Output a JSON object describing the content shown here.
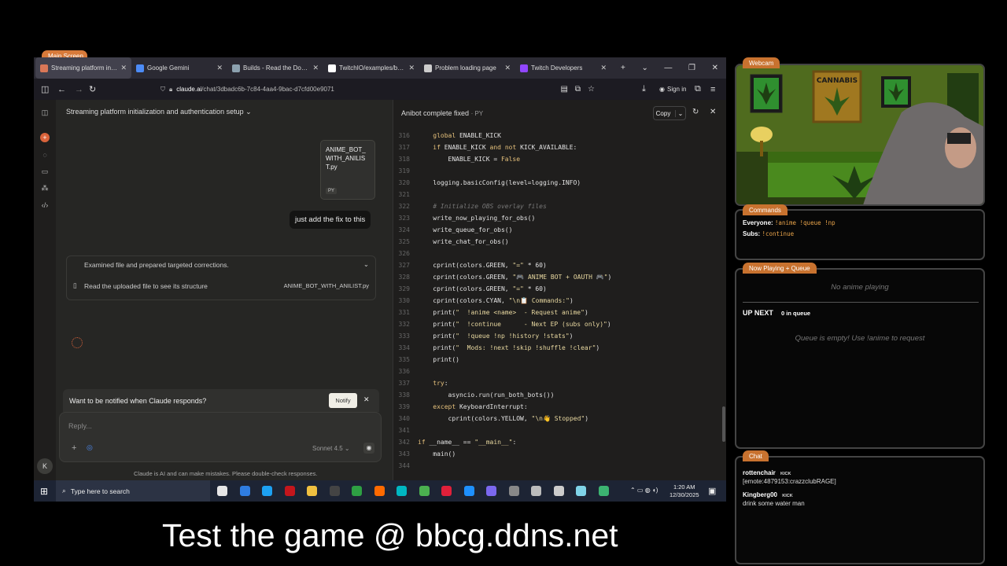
{
  "scene_label": "Main Screen",
  "browser": {
    "tabs": [
      {
        "title": "Streaming platform initializati",
        "active": true,
        "favicon_color": "#d97757"
      },
      {
        "title": "Google Gemini",
        "active": false,
        "favicon_color": "#4c8bf5"
      },
      {
        "title": "Builds - Read the Docs Comm",
        "active": false,
        "favicon_color": "#8ca1af"
      },
      {
        "title": "TwitchIO/examples/basic_bot",
        "active": false,
        "favicon_color": "#ffffff"
      },
      {
        "title": "Problem loading page",
        "active": false,
        "favicon_color": "#cccccc"
      },
      {
        "title": "Twitch Developers",
        "active": false,
        "favicon_color": "#9146ff"
      }
    ],
    "url_host": "claude.ai",
    "url_path": "/chat/3dbadc6b-7c84-4aa4-9bac-d7cfd00e9071",
    "sign_in": "Sign in"
  },
  "chat": {
    "title": "Streaming platform initialization and authentication setup",
    "attachment": {
      "name": "ANIME_BOT_WITH_ANILIST.py",
      "type": "PY"
    },
    "user_message": "just add the fix to this",
    "step_summary": "Examined file and prepared targeted corrections.",
    "step_detail": "Read the uploaded file to see its structure",
    "step_file": "ANIME_BOT_WITH_ANILIST.py",
    "notify_prompt": "Want to be notified when Claude responds?",
    "notify_button": "Notify",
    "reply_placeholder": "Reply...",
    "model": "Sonnet 4.5",
    "disclaimer": "Claude is AI and can make mistakes. Please double-check responses.",
    "avatar_initial": "K"
  },
  "code_panel": {
    "title": "Anibot complete fixed",
    "ext": "· PY",
    "copy_label": "Copy",
    "lines": [
      {
        "n": "316",
        "code": "    global ENABLE_KICK"
      },
      {
        "n": "317",
        "code": "    if ENABLE_KICK and not KICK_AVAILABLE:"
      },
      {
        "n": "318",
        "code": "        ENABLE_KICK = False"
      },
      {
        "n": "319",
        "code": ""
      },
      {
        "n": "320",
        "code": "    logging.basicConfig(level=logging.INFO)"
      },
      {
        "n": "321",
        "code": ""
      },
      {
        "n": "322",
        "code": "    # Initialize OBS overlay files"
      },
      {
        "n": "323",
        "code": "    write_now_playing_for_obs()"
      },
      {
        "n": "324",
        "code": "    write_queue_for_obs()"
      },
      {
        "n": "325",
        "code": "    write_chat_for_obs()"
      },
      {
        "n": "326",
        "code": ""
      },
      {
        "n": "327",
        "code": "    cprint(colors.GREEN, \"=\" * 60)"
      },
      {
        "n": "328",
        "code": "    cprint(colors.GREEN, \"🎮 ANIME BOT + OAUTH 🎮\")"
      },
      {
        "n": "329",
        "code": "    cprint(colors.GREEN, \"=\" * 60)"
      },
      {
        "n": "330",
        "code": "    cprint(colors.CYAN, \"\\n📋 Commands:\")"
      },
      {
        "n": "331",
        "code": "    print(\"  !anime <name>  - Request anime\")"
      },
      {
        "n": "332",
        "code": "    print(\"  !continue      - Next EP (subs only)\")"
      },
      {
        "n": "333",
        "code": "    print(\"  !queue !np !history !stats\")"
      },
      {
        "n": "334",
        "code": "    print(\"  Mods: !next !skip !shuffle !clear\")"
      },
      {
        "n": "335",
        "code": "    print()"
      },
      {
        "n": "336",
        "code": ""
      },
      {
        "n": "337",
        "code": "    try:"
      },
      {
        "n": "338",
        "code": "        asyncio.run(run_both_bots())"
      },
      {
        "n": "339",
        "code": "    except KeyboardInterrupt:"
      },
      {
        "n": "340",
        "code": "        cprint(colors.YELLOW, \"\\n👋 Stopped\")"
      },
      {
        "n": "341",
        "code": ""
      },
      {
        "n": "342",
        "code": "if __name__ == \"__main__\":"
      },
      {
        "n": "343",
        "code": "    main()"
      },
      {
        "n": "344",
        "code": ""
      }
    ]
  },
  "taskbar": {
    "search_placeholder": "Type here to search",
    "time": "1:20 AM",
    "date": "12/30/2025",
    "app_colors": [
      "#e6e6e6",
      "#2f7de1",
      "#1da1f2",
      "#c4161c",
      "#f0c040",
      "#444444",
      "#2ea043",
      "#ff6a00",
      "#00b7c3",
      "#4bb04f",
      "#e0203a",
      "#1e90ff",
      "#7b68ee",
      "#888888",
      "#bbbbbb",
      "#cccccc",
      "#7fd3e8",
      "#3cb371"
    ]
  },
  "ticker_text": "Test the game @ bbcg.ddns.net",
  "overlay": {
    "webcam_label": "Webcam",
    "webcam_sign": "CANNABIS",
    "commands_label": "Commands",
    "everyone_label": "Everyone:",
    "everyone_cmds": "!anime  !queue  !np",
    "subs_label": "Subs:",
    "subs_cmds": "!continue",
    "now_playing_label": "Now Playing + Queue",
    "now_playing_text": "No anime playing",
    "up_next_label": "UP NEXT",
    "queue_count": "0 in queue",
    "queue_empty": "Queue is empty! Use !anime to request",
    "chat_label": "Chat",
    "chat_messages": [
      {
        "user": "rottenchair",
        "platform": "KICK",
        "text": "[emote:4879153:crazzclubRAGE]"
      },
      {
        "user": "Kingberg00",
        "platform": "KICK",
        "text": "drink some water man"
      }
    ]
  }
}
